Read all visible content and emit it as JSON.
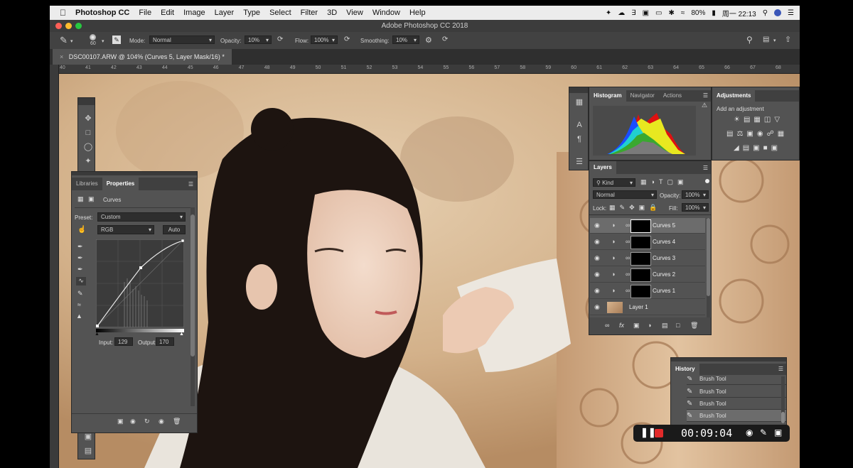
{
  "menubar": {
    "apple": "",
    "app": "Photoshop CC",
    "items": [
      "File",
      "Edit",
      "Image",
      "Layer",
      "Type",
      "Select",
      "Filter",
      "3D",
      "View",
      "Window",
      "Help"
    ],
    "battery": "80%",
    "clock": "周一 22:13"
  },
  "window": {
    "title": "Adobe Photoshop CC 2018"
  },
  "options": {
    "brush_size": "60",
    "mode_label": "Mode:",
    "mode_value": "Normal",
    "opacity_label": "Opacity:",
    "opacity_value": "10%",
    "flow_label": "Flow:",
    "flow_value": "100%",
    "smoothing_label": "Smoothing:",
    "smoothing_value": "10%"
  },
  "document": {
    "tab": "DSC00107.ARW @ 104% (Curves 5, Layer Mask/16) *"
  },
  "ruler": {
    "labels": [
      "40",
      "41",
      "42",
      "43",
      "44",
      "45",
      "46",
      "47",
      "48",
      "49",
      "50",
      "51",
      "52",
      "53",
      "54",
      "55",
      "56",
      "57",
      "58",
      "59",
      "60",
      "61",
      "62",
      "63",
      "64",
      "65",
      "66",
      "67",
      "68"
    ]
  },
  "properties": {
    "tabs": [
      "Libraries",
      "Properties"
    ],
    "type": "Curves",
    "preset_label": "Preset:",
    "preset_value": "Custom",
    "channel": "RGB",
    "auto_label": "Auto",
    "input_label": "Input:",
    "input_value": "129",
    "output_label": "Output:",
    "output_value": "170"
  },
  "histogram": {
    "tabs": [
      "Histogram",
      "Navigator",
      "Actions"
    ]
  },
  "adjustments": {
    "tab": "Adjustments",
    "add_label": "Add an adjustment"
  },
  "layers": {
    "tab": "Layers",
    "kind": "Kind",
    "blend": "Normal",
    "opacity_label": "Opacity:",
    "opacity_value": "100%",
    "lock_label": "Lock:",
    "fill_label": "Fill:",
    "fill_value": "100%",
    "rows": [
      {
        "name": "Curves 5",
        "selected": true
      },
      {
        "name": "Curves 4",
        "selected": false
      },
      {
        "name": "Curves 3",
        "selected": false
      },
      {
        "name": "Curves 2",
        "selected": false
      },
      {
        "name": "Curves 1",
        "selected": false
      },
      {
        "name": "Layer 1",
        "selected": false
      }
    ]
  },
  "history": {
    "tab": "History",
    "rows": [
      {
        "name": "Brush Tool",
        "selected": false
      },
      {
        "name": "Brush Tool",
        "selected": false
      },
      {
        "name": "Brush Tool",
        "selected": false
      },
      {
        "name": "Brush Tool",
        "selected": true
      }
    ]
  },
  "recorder": {
    "time": "00:09:04"
  },
  "colors": {
    "accent": "#2f7bff",
    "record_red": "#e22a2a",
    "panel_bg": "#535353"
  }
}
